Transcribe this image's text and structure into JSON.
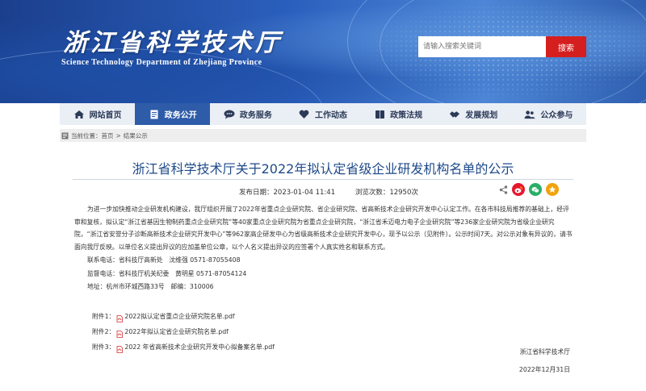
{
  "header": {
    "logo_cn": "浙江省科学技术厅",
    "logo_en": "Science Technology Department of Zhejiang Province",
    "search_placeholder": "请输入搜索关键词",
    "search_button": "搜索"
  },
  "nav": {
    "items": [
      {
        "label": "网站首页",
        "icon": "home-icon"
      },
      {
        "label": "政务公开",
        "icon": "document-icon",
        "active": true
      },
      {
        "label": "政务服务",
        "icon": "chat-icon"
      },
      {
        "label": "工作动态",
        "icon": "heart-icon"
      },
      {
        "label": "政策法规",
        "icon": "book-icon"
      },
      {
        "label": "发展规划",
        "icon": "handshake-icon"
      },
      {
        "label": "公众参与",
        "icon": "people-icon"
      }
    ]
  },
  "breadcrumb": {
    "prefix": "当前位置：",
    "home": "首页",
    "separator": ">",
    "current": "结果公示"
  },
  "article": {
    "title": "浙江省科学技术厅关于2022年拟认定省级企业研发机构名单的公示",
    "publish_label": "发布日期：2023-01-04 11:41",
    "views_label": "浏览次数：12950次",
    "paragraph": "为进一步加快推动企业研发机构建设，我厅组织开展了2022年省重点企业研究院、省企业研究院、省高新技术企业研究开发中心认定工作。在各市科技局推荐的基础上，经评审和复核，拟认定“浙江省基因生物制药重点企业研究院”等40家重点企业研究院为省重点企业研究院，“浙江省禾迈电力电子企业研究院”等236家企业研究院为省级企业研究院，“浙江省安誉分子诊断高新技术企业研究开发中心”等962家高企研发中心为省级高新技术企业研究开发中心，现予以公示（见附件）。公示时间7天。对公示对象有异议的，请书面向我厅反映。以单位名义提出异议的应加盖单位公章，以个人名义提出异议的应签署个人真实姓名和联系方式。",
    "contact_1": "联系电话：省科技厅高新处　沈维强 0571-87055408",
    "contact_2": "监督电话：省科技厅机关纪委　黄明星 0571-87054124",
    "address": "地址：杭州市环城西路33号　邮编：310006",
    "attachments": [
      {
        "prefix": "附件1：",
        "name": "2022拟认定省重点企业研究院名单.pdf"
      },
      {
        "prefix": "附件2：",
        "name": "2022年拟认定省企业研究院名单.pdf"
      },
      {
        "prefix": "附件3：",
        "name": "2022 年省高新技术企业研究开发中心拟备案名单.pdf"
      }
    ],
    "signature": "浙江省科学技术厅",
    "date": "2022年12月31日"
  },
  "colors": {
    "banner_blue": "#2b5fbd",
    "nav_active": "#2e5ca8",
    "search_red": "#d51f1f",
    "title_blue": "#1f4a8a",
    "weibo_red": "#e6162d",
    "wechat_green": "#2aae67",
    "star_gold": "#f0a30a"
  }
}
